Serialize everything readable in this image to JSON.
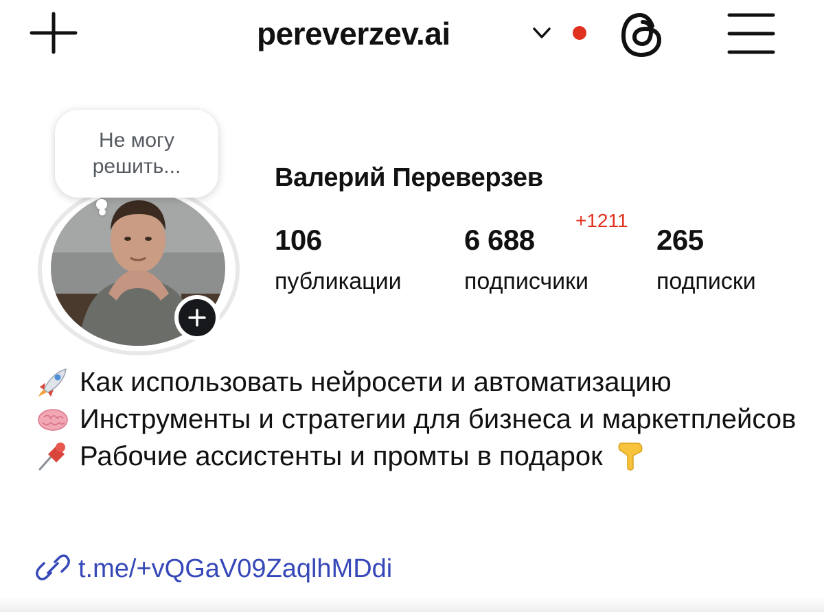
{
  "header": {
    "username": "pereverzev.ai",
    "new_post_icon": "plus-icon",
    "switch_account_icon": "chevron-down-icon",
    "notification_dot_color": "#e0301e",
    "threads_icon": "threads-icon",
    "menu_icon": "hamburger-menu-icon"
  },
  "note": {
    "text": "Не могу решить..."
  },
  "profile": {
    "full_name": "Валерий Переверзев",
    "avatar_icon": "profile-photo",
    "add_story_icon": "plus-icon"
  },
  "stats": {
    "posts": {
      "value": "106",
      "label": "публикации"
    },
    "followers": {
      "value": "6 688",
      "label": "подписчики",
      "delta": "+1211",
      "delta_color": "#e0301e"
    },
    "following": {
      "value": "265",
      "label": "подписки"
    }
  },
  "bio": {
    "line1": {
      "icon": "rocket-icon",
      "text": "Как использовать нейросети и автоматизацию"
    },
    "line2": {
      "icon": "brain-icon",
      "text": "Инструменты и стратегии для бизнеса и маркетплейсов"
    },
    "line3": {
      "icon": "pushpin-icon",
      "text": "Рабочие ассистенты и промты в подарок",
      "end_icon": "pointing-down-icon"
    },
    "link": {
      "icon": "link-icon",
      "text": "t.me/+vQGaV09ZaqlhMDdi",
      "color": "#3648b8"
    }
  }
}
